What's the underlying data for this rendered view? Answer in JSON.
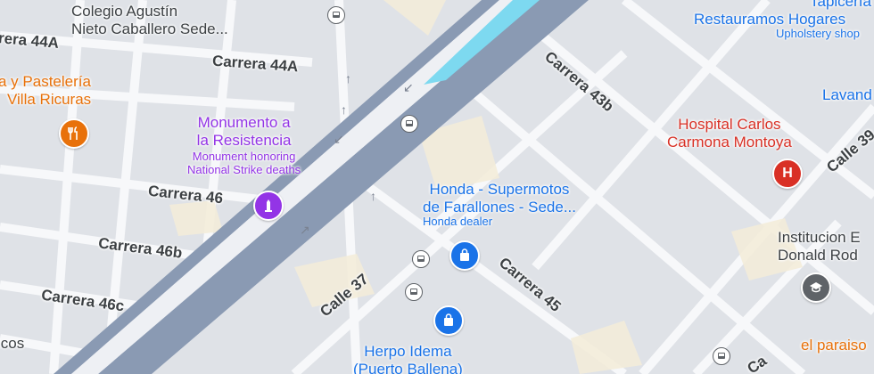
{
  "map": {
    "streets": {
      "carrera_44a_left": "rera 44A",
      "carrera_44a": "Carrera 44A",
      "carrera_46": "Carrera 46",
      "carrera_46b": "Carrera 46b",
      "carrera_46c": "Carrera 46c",
      "carrera_43b": "Carrera 43b",
      "carrera_45": "Carrera 45",
      "calle_37": "Calle 37",
      "calle_39": "Calle 39",
      "calle_bottom": "Ca"
    },
    "pois": {
      "colegio": {
        "line1": "Colegio Agustín",
        "line2": "Nieto Caballero Sede..."
      },
      "pasteleria": {
        "line1": "a y Pastelería",
        "line2": "Villa Ricuras",
        "icon": "restaurant-icon",
        "color": "#e8710a"
      },
      "monumento": {
        "line1": "Monumento a",
        "line2": "la Resistencia",
        "desc1": "Monument honoring",
        "desc2": "National Strike deaths",
        "icon": "monument-icon",
        "color": "#9334e6"
      },
      "honda": {
        "line1": "Honda - Supermotos",
        "line2": "de Farallones - Sede...",
        "desc": "Honda dealer",
        "icon": "shopping-bag-icon",
        "color": "#1a73e8"
      },
      "herpo": {
        "line1": "Herpo Idema",
        "line2": "(Puerto Ballena)",
        "icon": "shopping-bag-icon",
        "color": "#1a73e8"
      },
      "hospital": {
        "line1": "Hospital Carlos",
        "line2": "Carmona Montoya",
        "icon": "hospital-icon",
        "color": "#d93025"
      },
      "tapiceria": {
        "line1": "Tapicería",
        "line2": "Restauramos Hogares",
        "desc": "Upholstery shop"
      },
      "lavanderia": {
        "line1": "Lavand"
      },
      "institucion": {
        "line1": "Institucion E",
        "line2": "Donald Rod",
        "icon": "school-icon",
        "color": "#5f6368"
      },
      "paraiso": {
        "line1": "el paraiso"
      },
      "cos": {
        "line1": "icos"
      }
    },
    "icons": {
      "bus": "bus-stop-icon",
      "arrow": "one-way-arrow-icon"
    }
  }
}
